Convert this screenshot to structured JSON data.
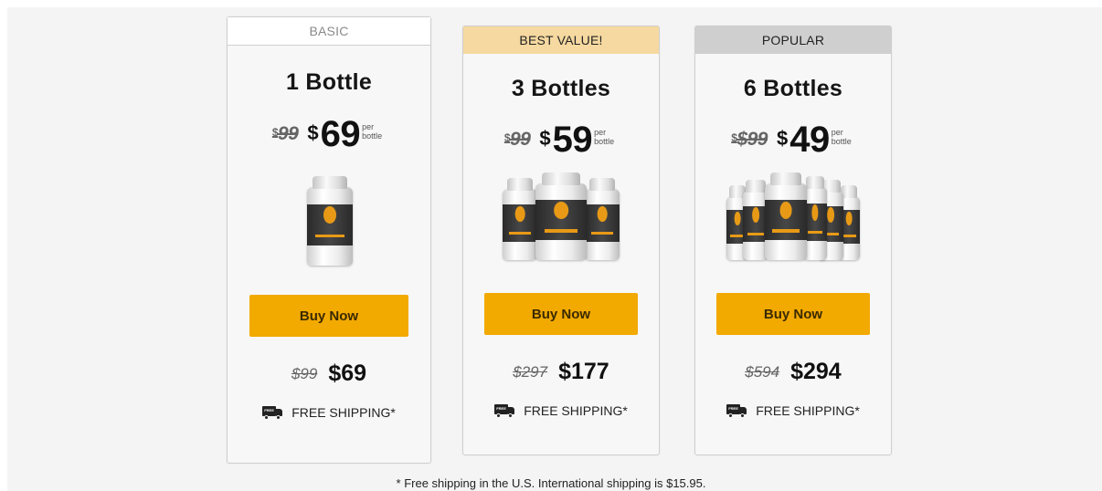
{
  "plans": [
    {
      "header": "BASIC",
      "quantity": "1 Bottle",
      "old_unit_currency": "$",
      "old_unit_price": "99",
      "new_unit_currency": "$",
      "new_unit_price": "69",
      "per_label": "per bottle",
      "button_label": "Buy Now",
      "old_total": "$99",
      "new_total": "$69",
      "shipping_label": "FREE SHIPPING*"
    },
    {
      "header": "BEST VALUE!",
      "quantity": "3 Bottles",
      "old_unit_currency": "$",
      "old_unit_price": "99",
      "new_unit_currency": "$",
      "new_unit_price": "59",
      "per_label": "per bottle",
      "button_label": "Buy Now",
      "old_total": "$297",
      "new_total": "$177",
      "shipping_label": "FREE SHIPPING*"
    },
    {
      "header": "POPULAR",
      "quantity": "6 Bottles",
      "old_unit_currency": "$",
      "old_unit_price": "$99",
      "new_unit_currency": "$",
      "new_unit_price": "49",
      "per_label": "per bottle",
      "button_label": "Buy Now",
      "old_total": "$594",
      "new_total": "$294",
      "shipping_label": "FREE SHIPPING*"
    }
  ],
  "truck_icon_text": "FREE",
  "footnote": "* Free shipping in the U.S. International shipping is $15.95.",
  "colors": {
    "button": "#f2a900",
    "best_value_header": "#f6d9a0",
    "popular_header": "#cfcfcf",
    "bottle_label": "#2a2a2a",
    "bottle_logo": "#e89a16"
  }
}
